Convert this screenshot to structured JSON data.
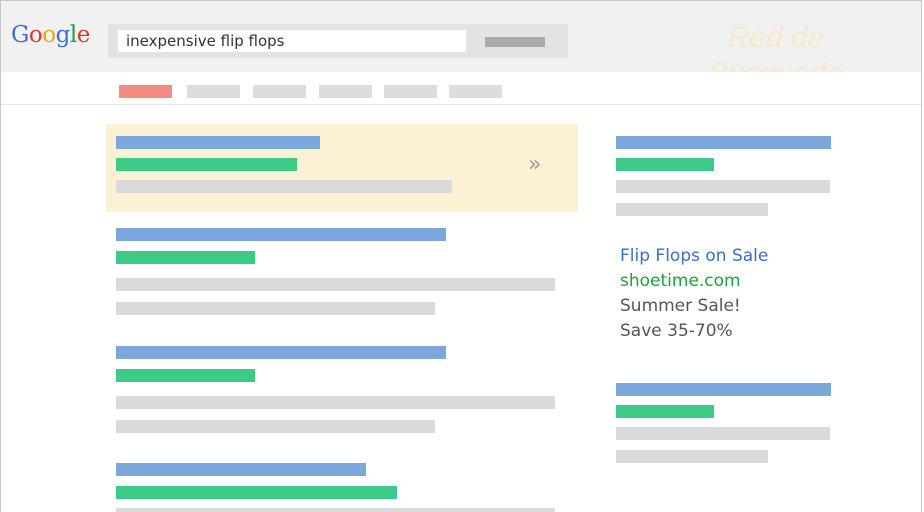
{
  "header": {
    "logo": {
      "letters": [
        "G",
        "o",
        "o",
        "g",
        "l",
        "e"
      ],
      "colors": [
        "#3b6fd6",
        "#d93a2b",
        "#e8a516",
        "#3b6fd6",
        "#1e9e3d",
        "#d93a2b"
      ]
    },
    "search": {
      "value": "inexpensive flip flops"
    },
    "watermark": "Red de Búsqueda"
  },
  "nav": {
    "tabs": [
      {
        "active": true
      },
      {
        "active": false
      },
      {
        "active": false
      },
      {
        "active": false
      },
      {
        "active": false
      },
      {
        "active": false
      }
    ]
  },
  "side_ad": {
    "title": "Flip Flops on Sale",
    "url": "shoetime.com",
    "line1": "Summer Sale!",
    "line2": "Save 35-70%"
  },
  "icons": {
    "ad_arrow": "double-chevron-right-icon"
  },
  "colors": {
    "title_blue": "#7ba7dc",
    "url_green": "#3ccb86",
    "text_gray": "#dadada",
    "ad_highlight": "#fcf1d4",
    "active_tab": "#f28b82"
  }
}
